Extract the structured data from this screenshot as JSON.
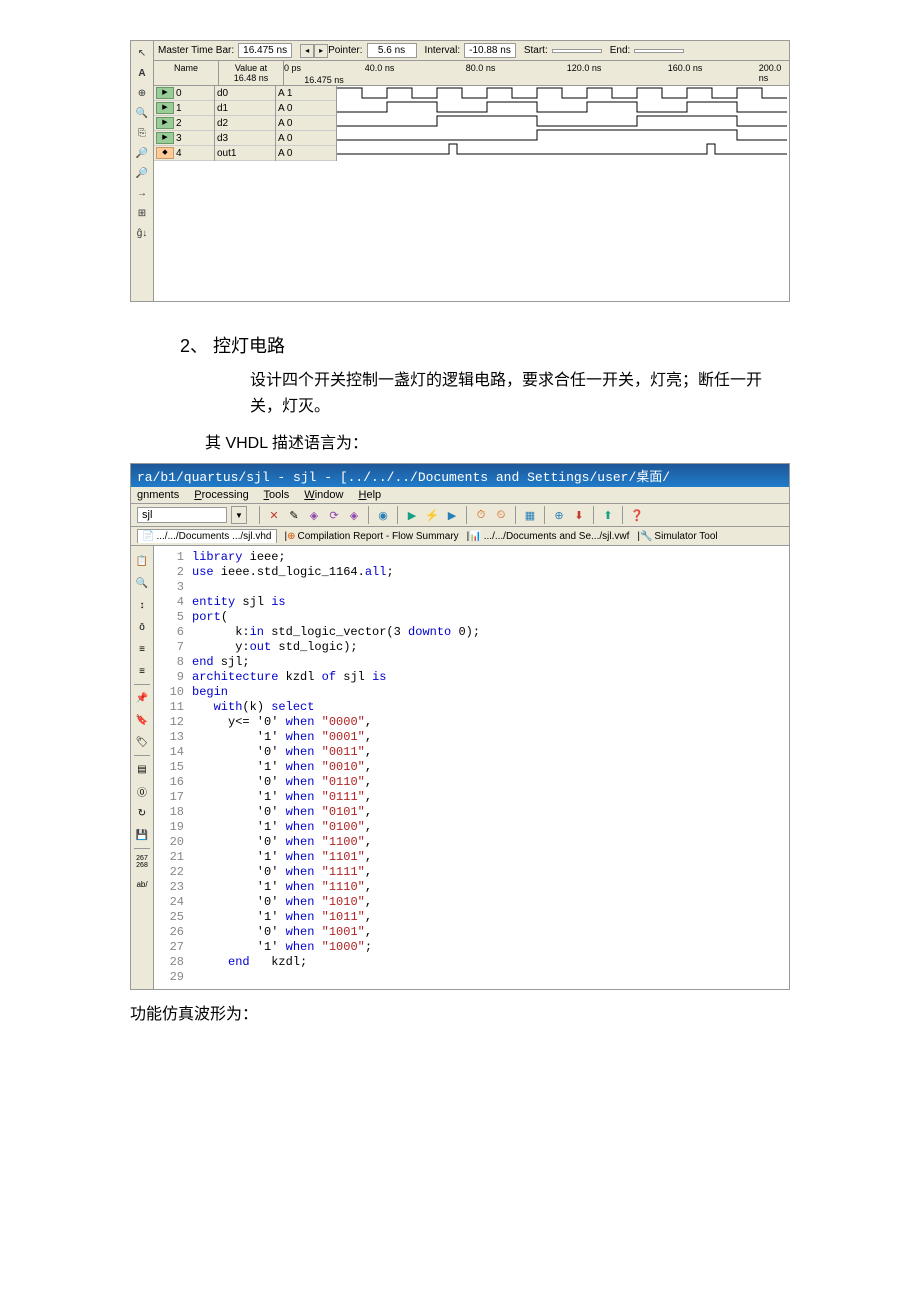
{
  "wave": {
    "header": {
      "master_label": "Master Time Bar:",
      "master_value": "16.475 ns",
      "pointer_label": "Pointer:",
      "pointer_value": "5.6 ns",
      "interval_label": "Interval:",
      "interval_value": "-10.88 ns",
      "start_label": "Start:",
      "start_value": "",
      "end_label": "End:",
      "end_value": ""
    },
    "cols": {
      "name": "Name",
      "value": "Value at",
      "value_sub": "16.48 ns",
      "ruler_left": "0 ps",
      "ruler_marker": "16.475 ns"
    },
    "ticks": [
      "40.0 ns",
      "80.0 ns",
      "120.0 ns",
      "160.0 ns",
      "200.0 ns"
    ],
    "signals": [
      {
        "idx": "0",
        "name": "d0",
        "value": "A 1"
      },
      {
        "idx": "1",
        "name": "d1",
        "value": "A 0"
      },
      {
        "idx": "2",
        "name": "d2",
        "value": "A 0"
      },
      {
        "idx": "3",
        "name": "d3",
        "value": "A 0"
      },
      {
        "idx": "4",
        "name": "out1",
        "value": "A 0"
      }
    ]
  },
  "section": {
    "title": "2、  控灯电路",
    "desc": "设计四个开关控制一盏灯的逻辑电路，要求合任一开关，灯亮；断任一开关，灯灭。",
    "sub": "其 VHDL 描述语言为："
  },
  "quartus": {
    "title": "ra/b1/quartus/sjl - sjl - [../../../Documents and Settings/user/桌面/",
    "menus": [
      "gnments",
      "Processing",
      "Tools",
      "Window",
      "Help"
    ],
    "dropdown": "sjl",
    "tabs": [
      {
        "icon": "📄",
        "label": ".../.../Documents .../sjl.vhd",
        "active": true
      },
      {
        "icon": "⊕",
        "label": "Compilation Report - Flow Summary",
        "active": false
      },
      {
        "icon": "📊",
        "label": ".../.../Documents and Se.../sjl.vwf",
        "active": false
      },
      {
        "icon": "🔧",
        "label": "Simulator Tool",
        "active": false
      }
    ]
  },
  "code": [
    {
      "n": 1,
      "t": "library",
      "r": " ieee;"
    },
    {
      "n": 2,
      "t": "use",
      "r": " ieee.std_logic_1164.",
      "t2": "all",
      "r2": ";"
    },
    {
      "n": 3,
      "t": "",
      "r": ""
    },
    {
      "n": 4,
      "t": "entity",
      "r": " sjl ",
      "t2": "is",
      "r2": ""
    },
    {
      "n": 5,
      "t": "port",
      "r": "("
    },
    {
      "n": 6,
      "t": "",
      "r": "      k:",
      "t2": "in",
      "r2": " std_logic_vector(3 ",
      "t3": "downto",
      "r3": " 0);"
    },
    {
      "n": 7,
      "t": "",
      "r": "      y:",
      "t2": "out",
      "r2": " std_logic);"
    },
    {
      "n": 8,
      "t": "end",
      "r": " sjl;"
    },
    {
      "n": 9,
      "t": "architecture",
      "r": " kzdl ",
      "t2": "of",
      "r2": " sjl ",
      "t3": "is",
      "r3": ""
    },
    {
      "n": 10,
      "t": "begin",
      "r": ""
    },
    {
      "n": 11,
      "t": "",
      "r": "   ",
      "t2": "with",
      "r2": "(k) ",
      "t3": "select",
      "r3": ""
    },
    {
      "n": 12,
      "t": "",
      "r": "     y<= '0' ",
      "t2": "when",
      "r2": " ",
      "s": "\"0000\"",
      "r3": ","
    },
    {
      "n": 13,
      "t": "",
      "r": "         '1' ",
      "t2": "when",
      "r2": " ",
      "s": "\"0001\"",
      "r3": ","
    },
    {
      "n": 14,
      "t": "",
      "r": "         '0' ",
      "t2": "when",
      "r2": " ",
      "s": "\"0011\"",
      "r3": ","
    },
    {
      "n": 15,
      "t": "",
      "r": "         '1' ",
      "t2": "when",
      "r2": " ",
      "s": "\"0010\"",
      "r3": ","
    },
    {
      "n": 16,
      "t": "",
      "r": "         '0' ",
      "t2": "when",
      "r2": " ",
      "s": "\"0110\"",
      "r3": ","
    },
    {
      "n": 17,
      "t": "",
      "r": "         '1' ",
      "t2": "when",
      "r2": " ",
      "s": "\"0111\"",
      "r3": ","
    },
    {
      "n": 18,
      "t": "",
      "r": "         '0' ",
      "t2": "when",
      "r2": " ",
      "s": "\"0101\"",
      "r3": ","
    },
    {
      "n": 19,
      "t": "",
      "r": "         '1' ",
      "t2": "when",
      "r2": " ",
      "s": "\"0100\"",
      "r3": ","
    },
    {
      "n": 20,
      "t": "",
      "r": "         '0' ",
      "t2": "when",
      "r2": " ",
      "s": "\"1100\"",
      "r3": ","
    },
    {
      "n": 21,
      "t": "",
      "r": "         '1' ",
      "t2": "when",
      "r2": " ",
      "s": "\"1101\"",
      "r3": ","
    },
    {
      "n": 22,
      "t": "",
      "r": "         '0' ",
      "t2": "when",
      "r2": " ",
      "s": "\"1111\"",
      "r3": ","
    },
    {
      "n": 23,
      "t": "",
      "r": "         '1' ",
      "t2": "when",
      "r2": " ",
      "s": "\"1110\"",
      "r3": ","
    },
    {
      "n": 24,
      "t": "",
      "r": "         '0' ",
      "t2": "when",
      "r2": " ",
      "s": "\"1010\"",
      "r3": ","
    },
    {
      "n": 25,
      "t": "",
      "r": "         '1' ",
      "t2": "when",
      "r2": " ",
      "s": "\"1011\"",
      "r3": ","
    },
    {
      "n": 26,
      "t": "",
      "r": "         '0' ",
      "t2": "when",
      "r2": " ",
      "s": "\"1001\"",
      "r3": ","
    },
    {
      "n": 27,
      "t": "",
      "r": "         '1' ",
      "t2": "when",
      "r2": " ",
      "s": "\"1000\"",
      "r3": ";"
    },
    {
      "n": 28,
      "t": "",
      "r": "     ",
      "t2": "end",
      "r2": "   kzdl;"
    },
    {
      "n": 29,
      "t": "",
      "r": ""
    }
  ],
  "footer": "功能仿真波形为："
}
